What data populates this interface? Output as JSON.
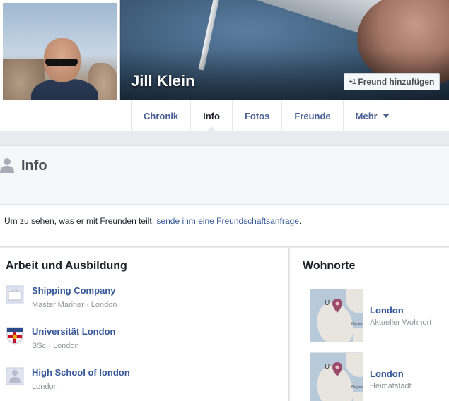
{
  "profile": {
    "name": "Jill Klein",
    "add_friend_label": "Freund hinzufügen",
    "add_friend_icon": "add-friend-icon"
  },
  "tabs": [
    {
      "label": "Chronik",
      "active": false
    },
    {
      "label": "Info",
      "active": true
    },
    {
      "label": "Fotos",
      "active": false
    },
    {
      "label": "Freunde",
      "active": false
    },
    {
      "label": "Mehr",
      "active": false
    }
  ],
  "info": {
    "title": "Info",
    "notice_text": "Um zu sehen, was er mit Freunden teilt, ",
    "notice_link": "sende ihm eine Freundschaftsanfrage",
    "notice_end": "."
  },
  "work": {
    "title": "Arbeit und Ausbildung",
    "items": [
      {
        "name": "Shipping Company",
        "detail": "Master Mariner · London",
        "icon": "briefcase-icon"
      },
      {
        "name": "Universität London",
        "detail": "BSc · London",
        "icon": "university-crest-icon"
      },
      {
        "name": "High School of london",
        "detail": "London",
        "icon": "school-icon"
      }
    ]
  },
  "places": {
    "title": "Wohnorte",
    "items": [
      {
        "name": "London",
        "detail": "Aktueller Wohnort",
        "map_label": "U",
        "map_sublabel": "Belgien"
      },
      {
        "name": "London",
        "detail": "Heimatstadt",
        "map_label": "U",
        "map_sublabel": "Belgien"
      }
    ]
  },
  "colors": {
    "link": "#365899",
    "background": "#e9ebee",
    "muted": "#90949c"
  }
}
